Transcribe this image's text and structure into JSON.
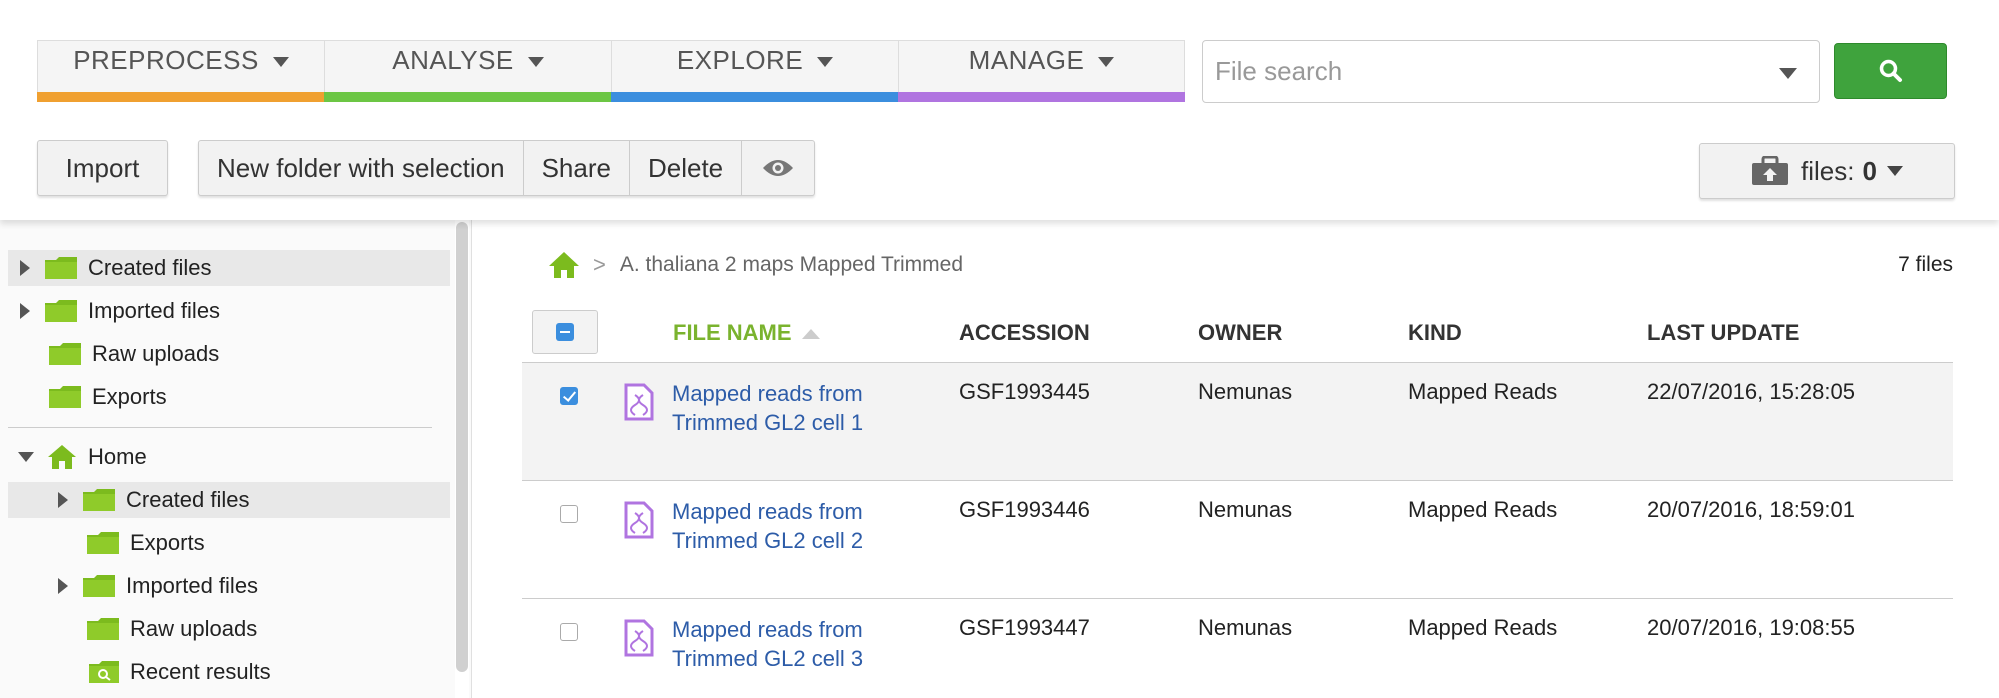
{
  "nav": {
    "tabs": [
      {
        "label": "PREPROCESS",
        "color": "#f0a030"
      },
      {
        "label": "ANALYSE",
        "color": "#6cc644"
      },
      {
        "label": "EXPLORE",
        "color": "#3b8ede"
      },
      {
        "label": "MANAGE",
        "color": "#b074e0"
      }
    ]
  },
  "search": {
    "placeholder": "File search",
    "value": ""
  },
  "toolbar": {
    "import_label": "Import",
    "new_folder_label": "New folder with selection",
    "share_label": "Share",
    "delete_label": "Delete",
    "files_label": "files:",
    "files_count": "0"
  },
  "sidebar": {
    "items": [
      {
        "label": "Created files",
        "expander": "right",
        "icon": "folder-icon"
      },
      {
        "label": "Imported files",
        "expander": "right",
        "icon": "folder-icon"
      },
      {
        "label": "Raw uploads",
        "expander": "none",
        "icon": "folder-icon"
      },
      {
        "label": "Exports",
        "expander": "none",
        "icon": "folder-icon"
      }
    ],
    "home": {
      "label": "Home",
      "children": [
        {
          "label": "Created files",
          "expander": "right",
          "icon": "folder-icon"
        },
        {
          "label": "Exports",
          "expander": "none",
          "icon": "folder-icon"
        },
        {
          "label": "Imported files",
          "expander": "right",
          "icon": "folder-icon"
        },
        {
          "label": "Raw uploads",
          "expander": "none",
          "icon": "folder-icon"
        },
        {
          "label": "Recent results",
          "expander": "none",
          "icon": "search-folder-icon"
        }
      ]
    }
  },
  "breadcrumb": {
    "separator": ">",
    "path": "A. thaliana 2 maps Mapped Trimmed"
  },
  "file_count": "7 files",
  "table": {
    "columns": [
      "FILE NAME",
      "ACCESSION",
      "OWNER",
      "KIND",
      "LAST UPDATE"
    ],
    "rows": [
      {
        "name": "Mapped reads from Trimmed GL2 cell 1",
        "accession": "GSF1993445",
        "owner": "Nemunas",
        "kind": "Mapped Reads",
        "updated": "22/07/2016, 15:28:05",
        "checked": true
      },
      {
        "name": "Mapped reads from Trimmed GL2 cell 2",
        "accession": "GSF1993446",
        "owner": "Nemunas",
        "kind": "Mapped Reads",
        "updated": "20/07/2016, 18:59:01",
        "checked": false
      },
      {
        "name": "Mapped reads from Trimmed GL2 cell 3",
        "accession": "GSF1993447",
        "owner": "Nemunas",
        "kind": "Mapped Reads",
        "updated": "20/07/2016, 19:08:55",
        "checked": false
      }
    ]
  },
  "colors": {
    "accent_green": "#3fa33d",
    "link_blue": "#2d5ca8",
    "sort_green": "#7ab32e",
    "folder_green": "#7cbb1e",
    "file_purple": "#b074e0"
  }
}
